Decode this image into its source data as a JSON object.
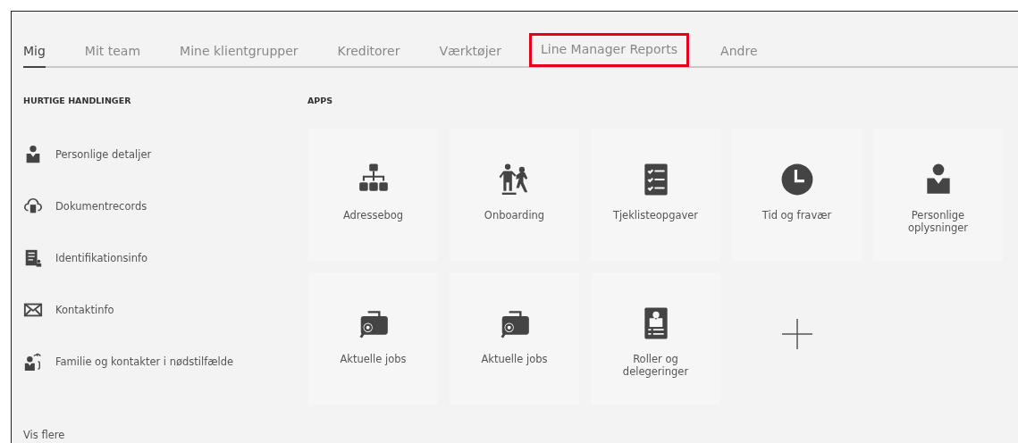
{
  "tabs": [
    {
      "label": "Mig",
      "selected": true,
      "highlighted": false
    },
    {
      "label": "Mit team",
      "selected": false,
      "highlighted": false
    },
    {
      "label": "Mine klientgrupper",
      "selected": false,
      "highlighted": false
    },
    {
      "label": "Kreditorer",
      "selected": false,
      "highlighted": false
    },
    {
      "label": "Værktøjer",
      "selected": false,
      "highlighted": false
    },
    {
      "label": "Line Manager Reports",
      "selected": false,
      "highlighted": true
    },
    {
      "label": "Andre",
      "selected": false,
      "highlighted": false
    }
  ],
  "quick_actions": {
    "heading": "HURTIGE HANDLINGER",
    "items": [
      {
        "kind": "person",
        "label": "Personlige detaljer"
      },
      {
        "kind": "cloud",
        "label": "Dokumentrecords"
      },
      {
        "kind": "idcard",
        "label": "Identifikationsinfo"
      },
      {
        "kind": "mail",
        "label": "Kontaktinfo"
      },
      {
        "kind": "family",
        "label": "Familie og kontakter i nødstilfælde"
      }
    ],
    "more": "Vis flere"
  },
  "apps": {
    "heading": "APPS",
    "tiles": [
      {
        "kind": "org",
        "label": "Adressebog"
      },
      {
        "kind": "onboard",
        "label": "Onboarding"
      },
      {
        "kind": "checklist",
        "label": "Tjeklisteopgaver"
      },
      {
        "kind": "clock",
        "label": "Tid og fravær"
      },
      {
        "kind": "person",
        "label": "Personlige oplysninger"
      },
      {
        "kind": "jobs",
        "label": "Aktuelle jobs"
      },
      {
        "kind": "jobs",
        "label": "Aktuelle jobs"
      },
      {
        "kind": "badge",
        "label": "Roller og delegeringer"
      },
      {
        "kind": "add"
      }
    ]
  }
}
